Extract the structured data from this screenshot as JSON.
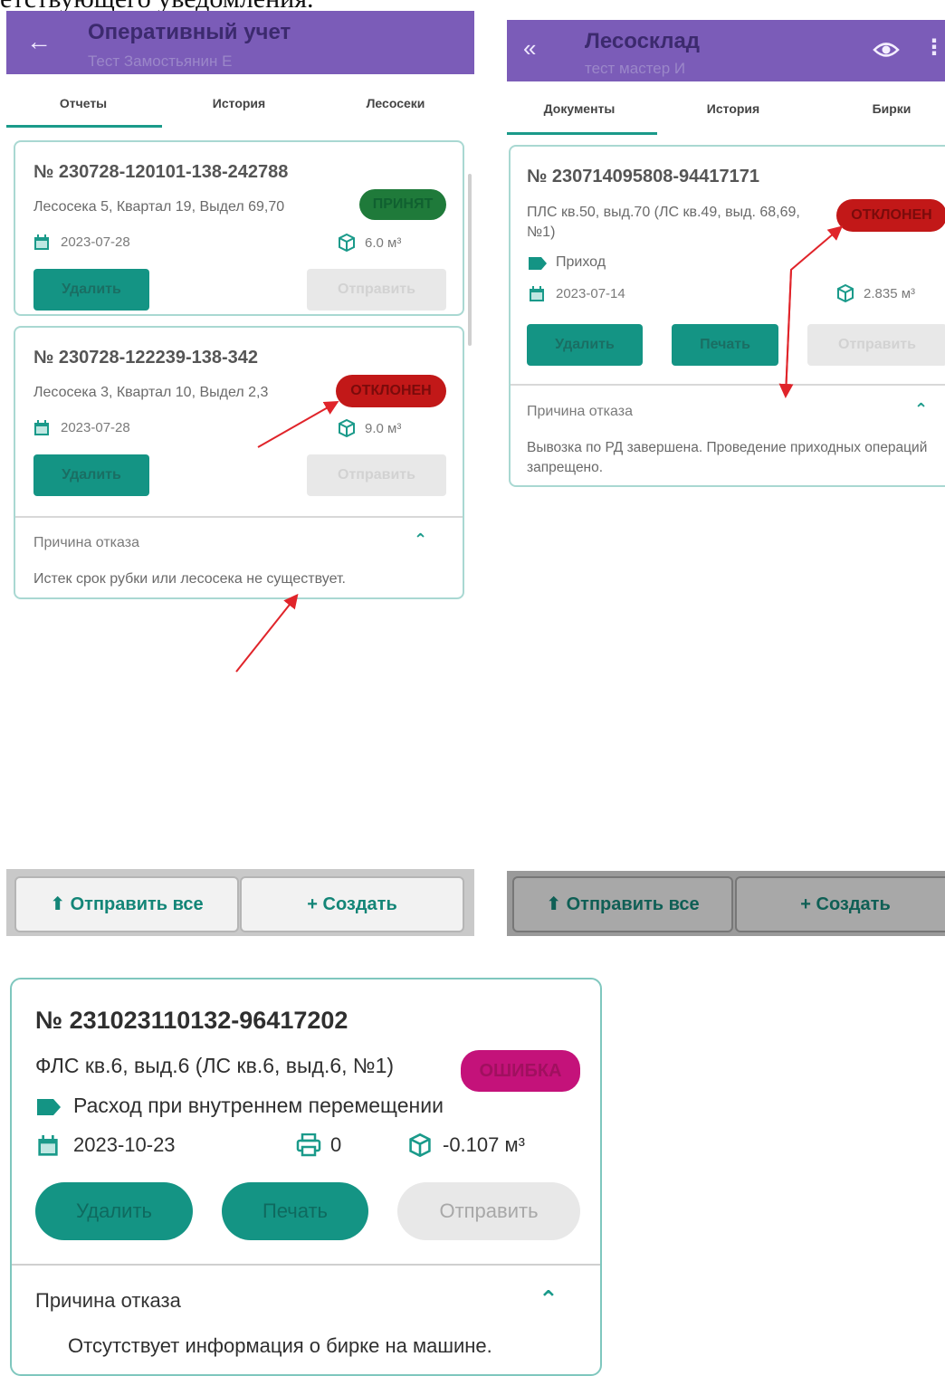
{
  "document": {
    "caption_fragment": "етствующего уведомления."
  },
  "screen1": {
    "title": "Оперативный учет",
    "subtitle": "Тест Замостьянин Е",
    "tabs": [
      "Отчеты",
      "История",
      "Лесосеки"
    ],
    "cards": [
      {
        "number": "№ 230728-120101-138-242788",
        "place": "Лесосека 5, Квартал 19, Выдел 69,70",
        "status": "ПРИНЯТ",
        "date": "2023-07-28",
        "volume": "6.0 м³",
        "delete": "Удалить",
        "send": "Отправить"
      },
      {
        "number": "№ 230728-122239-138-342",
        "place": "Лесосека 3, Квартал 10, Выдел 2,3",
        "status": "ОТКЛОНЕН",
        "date": "2023-07-28",
        "volume": "9.0 м³",
        "delete": "Удалить",
        "send": "Отправить",
        "reason_title": "Причина отказа",
        "reason_text": "Истек срок рубки или лесосека не существует."
      }
    ],
    "bottom": {
      "send_all": "Отправить все",
      "create": "Создать"
    }
  },
  "screen2": {
    "title": "Лесосклад",
    "subtitle": "тест мастер И",
    "tabs": [
      "Документы",
      "История",
      "Бирки"
    ],
    "card": {
      "number": "№ 230714095808-94417171",
      "place": "ПЛС кв.50, выд.70 (ЛС кв.49, выд. 68,69, №1)",
      "status": "ОТКЛОНЕН",
      "operation": "Приход",
      "date": "2023-07-14",
      "volume": "2.835 м³",
      "delete": "Удалить",
      "print": "Печать",
      "send": "Отправить",
      "reason_title": "Причина отказа",
      "reason_text": "Вывозка по РД завершена. Проведение приходных операций запрещено."
    },
    "bottom": {
      "send_all": "Отправить все",
      "create": "Создать"
    }
  },
  "screen3": {
    "card": {
      "number": "№ 231023110132-96417202",
      "place": "ФЛС кв.6, выд.6 (ЛС кв.6, выд.6, №1)",
      "status": "ОШИБКА",
      "operation": "Расход при внутреннем перемещении",
      "date": "2023-10-23",
      "prints": "0",
      "volume": "-0.107 м³",
      "delete": "Удалить",
      "print": "Печать",
      "send": "Отправить",
      "reason_title": "Причина отказа",
      "reason_text": "Отсутствует информация о бирке на машине."
    }
  }
}
